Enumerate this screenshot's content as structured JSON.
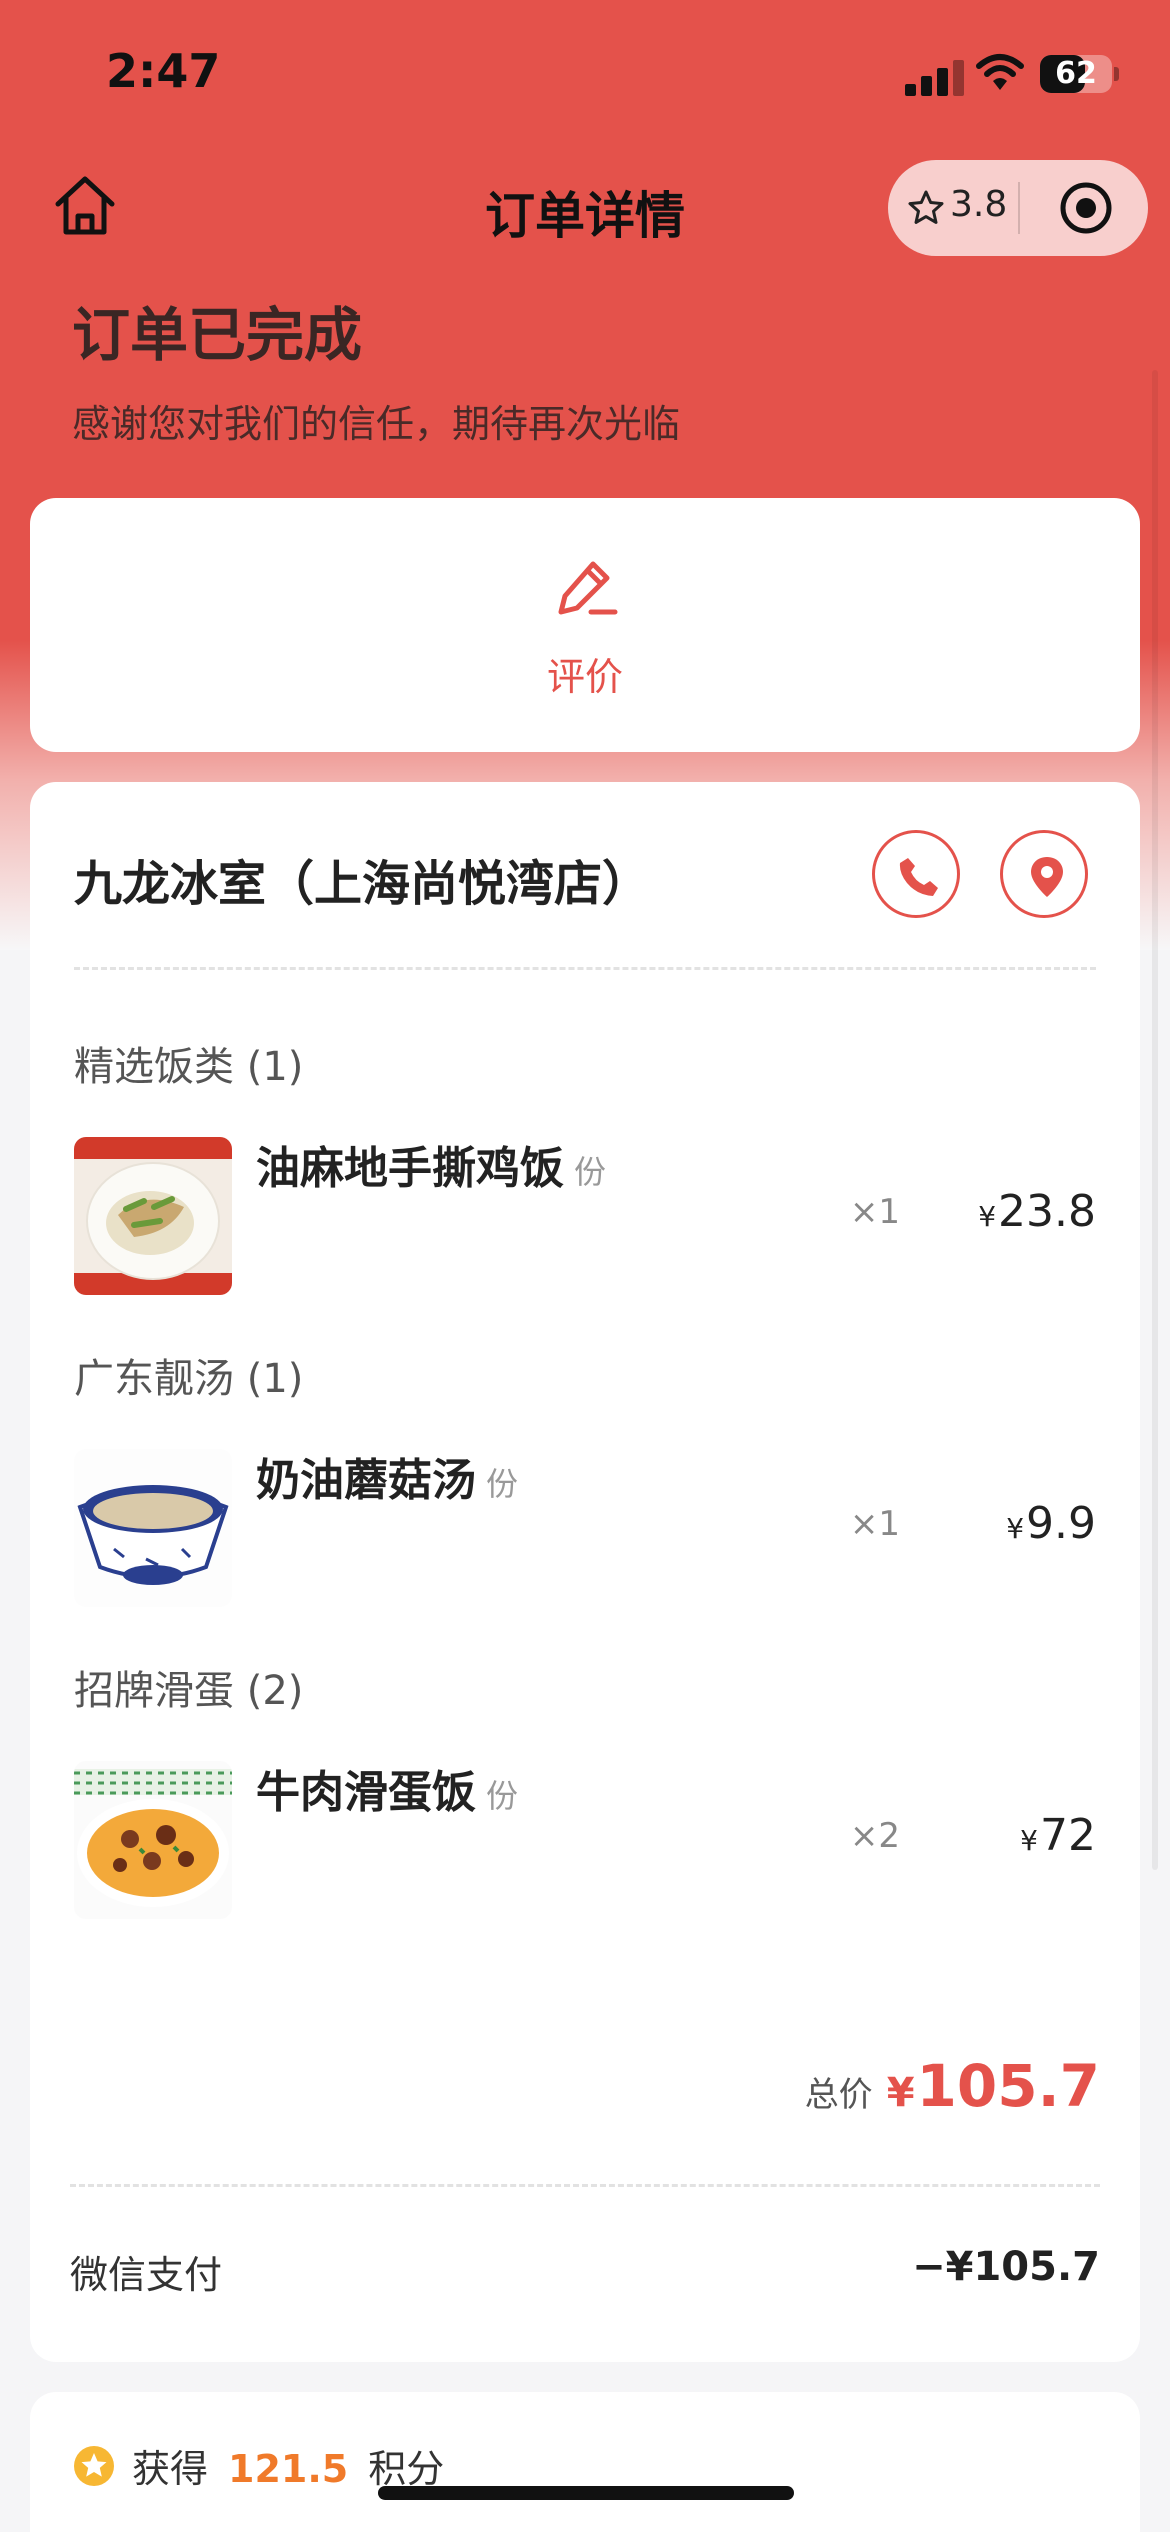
{
  "status_bar": {
    "time": "2:47",
    "battery": "62",
    "battery_level_percent": 62
  },
  "nav": {
    "title": "订单详情",
    "rating": "3.8"
  },
  "order_status": {
    "heading": "订单已完成",
    "subtitle": "感谢您对我们的信任，期待再次光临"
  },
  "review": {
    "label": "评价"
  },
  "shop": {
    "name": "九龙冰室（上海尚悦湾店）"
  },
  "categories": [
    {
      "title": "精选饭类 (1)",
      "item": {
        "name": "油麻地手撕鸡饭",
        "unit": "份",
        "qty": "×1",
        "currency": "¥",
        "price": "23.8"
      }
    },
    {
      "title": "广东靓汤 (1)",
      "item": {
        "name": "奶油蘑菇汤",
        "unit": "份",
        "qty": "×1",
        "currency": "¥",
        "price": "9.9"
      }
    },
    {
      "title": "招牌滑蛋 (2)",
      "item": {
        "name": "牛肉滑蛋饭",
        "unit": "份",
        "qty": "×2",
        "currency": "¥",
        "price": "72"
      }
    }
  ],
  "total": {
    "label": "总价",
    "currency": "¥",
    "value": "105.7"
  },
  "payment": {
    "method": "微信支付",
    "amount": "−¥105.7"
  },
  "points": {
    "prefix": "获得",
    "value": "121.5",
    "suffix": "积分"
  },
  "colors": {
    "brand": "#e4524b",
    "points": "#f07a2a"
  },
  "icons": [
    "home-icon",
    "star-icon",
    "target-icon",
    "edit-icon",
    "phone-icon",
    "location-icon",
    "points-icon"
  ]
}
